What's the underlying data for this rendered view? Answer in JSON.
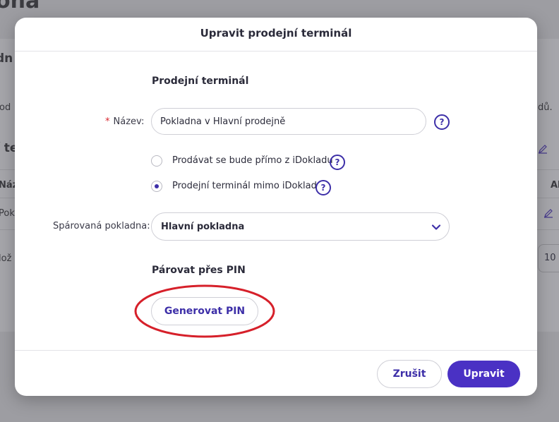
{
  "background": {
    "title": "ona",
    "left_fragments": [
      "dn",
      "rod",
      "í te",
      "Náz",
      "Pok",
      "lož"
    ],
    "right_fragments": [
      "dů.",
      "Al"
    ],
    "pager_value": "10"
  },
  "modal": {
    "title": "Upravit prodejní terminál",
    "section_terminal": "Prodejní terminál",
    "name_label": "Název:",
    "name_required_mark": "*",
    "name_value": "Pokladna v Hlavní prodejně",
    "help_glyph": "?",
    "radio_options": [
      {
        "label": "Prodávat se bude přímo z iDokladu",
        "checked": false
      },
      {
        "label": "Prodejní terminál mimo iDoklad",
        "checked": true
      }
    ],
    "paired_label": "Spárovaná pokladna:",
    "paired_value": "Hlavní pokladna",
    "section_pin": "Párovat přes PIN",
    "generate_pin_button": "Generovat PIN",
    "cancel_button": "Zrušit",
    "submit_button": "Upravit"
  },
  "colors": {
    "accent": "#4a31c4",
    "accent_text": "#3d2fa8",
    "required": "#d8262f",
    "annotation": "#d6202a"
  },
  "icons": {
    "help": "question-circle-icon",
    "select_chevron": "chevron-down-icon",
    "edit": "pencil-icon"
  }
}
